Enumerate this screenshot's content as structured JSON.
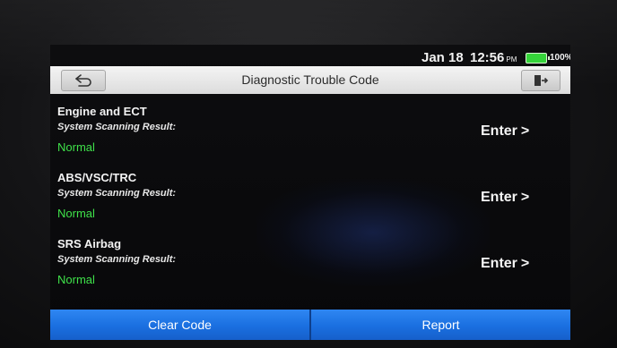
{
  "status": {
    "date": "Jan 18",
    "time": "12:56",
    "ampm": "PM",
    "battery_percent_text": "100%",
    "battery_level": 1.0,
    "battery_color": "#35d43a"
  },
  "header": {
    "title": "Diagnostic Trouble Code",
    "back_icon": "back-arrow-icon",
    "exit_icon": "exit-door-icon"
  },
  "systems": [
    {
      "name": "Engine and ECT",
      "result_label": "System Scanning Result:",
      "result": "Normal",
      "action": "Enter"
    },
    {
      "name": "ABS/VSC/TRC",
      "result_label": "System Scanning Result:",
      "result": "Normal",
      "action": "Enter"
    },
    {
      "name": "SRS Airbag",
      "result_label": "System Scanning Result:",
      "result": "Normal",
      "action": "Enter"
    }
  ],
  "footer": {
    "clear_code": "Clear Code",
    "report": "Report"
  },
  "colors": {
    "accent_blue": "#1a6fe0",
    "status_green": "#3fe24a"
  }
}
